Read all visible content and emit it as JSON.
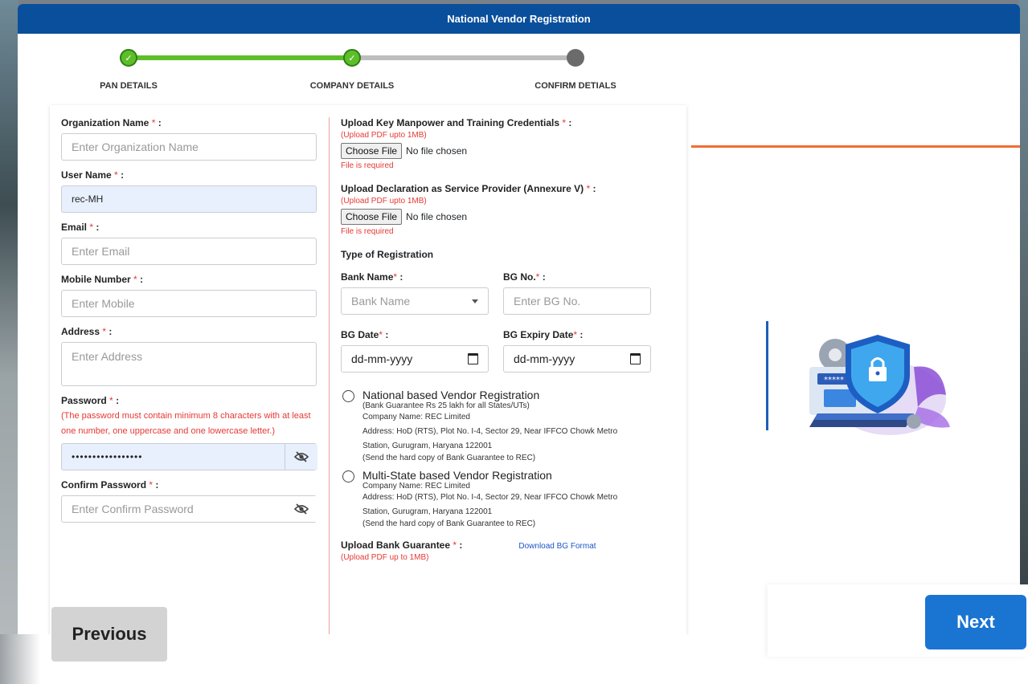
{
  "modal": {
    "title": "National Vendor Registration"
  },
  "stepper": {
    "steps": [
      {
        "label": "PAN DETAILS",
        "status": "done"
      },
      {
        "label": "COMPANY DETAILS",
        "status": "done"
      },
      {
        "label": "CONFIRM DETIALS",
        "status": "pending"
      }
    ]
  },
  "form": {
    "org_name": {
      "label": "Organization Name",
      "placeholder": "Enter Organization Name"
    },
    "user_name": {
      "label": "User Name",
      "value": "rec-MH"
    },
    "email": {
      "label": "Email",
      "placeholder": "Enter Email"
    },
    "mobile": {
      "label": "Mobile Number",
      "placeholder": "Enter Mobile"
    },
    "address": {
      "label": "Address",
      "placeholder": "Enter Address"
    },
    "password": {
      "label": "Password",
      "hint": "(The password must contain minimum 8 characters with at least one number, one uppercase and one lowercase letter.)",
      "value": "•••••••••••••••••"
    },
    "confirm_password": {
      "label": "Confirm Password",
      "placeholder": "Enter Confirm Password"
    },
    "required_mark": "*",
    "colon": ":",
    "upload_manpower": {
      "label": "Upload Key Manpower and Training Credentials",
      "note": "(Upload PDF upto 1MB)",
      "button": "Choose File",
      "status": "No file chosen",
      "error": "File is required"
    },
    "upload_declaration": {
      "label": "Upload Declaration as Service Provider (Annexure V)",
      "note": "(Upload PDF upto 1MB)",
      "button": "Choose File",
      "status": "No file chosen",
      "error": "File is required"
    },
    "type_of_registration": "Type of Registration",
    "bank_name": {
      "label": "Bank Name",
      "placeholder": "Bank Name"
    },
    "bg_no": {
      "label": "BG No.",
      "placeholder": "Enter BG No."
    },
    "bg_date": {
      "label": "BG Date",
      "value": "dd-mm-yyyy"
    },
    "bg_expiry": {
      "label": "BG Expiry Date",
      "value": "dd-mm-yyyy"
    },
    "national_option": {
      "title": "National based Vendor Registration",
      "sub": "(Bank Guarantee Rs 25 lakh for all States/UTs)",
      "company": "Company Name: REC Limited",
      "address": "Address: HoD (RTS), Plot No. I-4, Sector 29, Near IFFCO Chowk Metro Station, Gurugram, Haryana 122001",
      "note": "(Send the hard copy of Bank Guarantee to REC)"
    },
    "multistate_option": {
      "title": "Multi-State based Vendor Registration",
      "company": "Company Name: REC Limited",
      "address": "Address: HoD (RTS), Plot No. I-4, Sector 29, Near IFFCO Chowk Metro Station, Gurugram, Haryana 122001",
      "note": "(Send the hard copy of Bank Guarantee to REC)"
    },
    "upload_bg": {
      "label": "Upload Bank Guarantee",
      "link": "Download BG Format",
      "note": "(Upload PDF up to 1MB)"
    }
  },
  "buttons": {
    "previous": "Previous",
    "next": "Next"
  },
  "colors": {
    "header": "#0a4f9c",
    "step_done": "#5cbf2a",
    "accent_orange": "#f26d34",
    "next_button": "#1a74d2"
  },
  "icons": {
    "eye": "eye-off-icon",
    "calendar": "calendar-icon",
    "illustration": "security-shield-laptop-illustration"
  }
}
